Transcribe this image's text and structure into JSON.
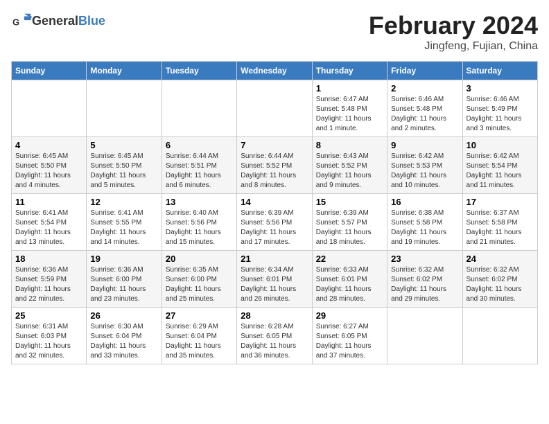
{
  "header": {
    "logo_general": "General",
    "logo_blue": "Blue",
    "month_year": "February 2024",
    "location": "Jingfeng, Fujian, China"
  },
  "weekdays": [
    "Sunday",
    "Monday",
    "Tuesday",
    "Wednesday",
    "Thursday",
    "Friday",
    "Saturday"
  ],
  "weeks": [
    [
      {
        "day": "",
        "sunrise": "",
        "sunset": "",
        "daylight": ""
      },
      {
        "day": "",
        "sunrise": "",
        "sunset": "",
        "daylight": ""
      },
      {
        "day": "",
        "sunrise": "",
        "sunset": "",
        "daylight": ""
      },
      {
        "day": "",
        "sunrise": "",
        "sunset": "",
        "daylight": ""
      },
      {
        "day": "1",
        "sunrise": "Sunrise: 6:47 AM",
        "sunset": "Sunset: 5:48 PM",
        "daylight": "Daylight: 11 hours and 1 minute."
      },
      {
        "day": "2",
        "sunrise": "Sunrise: 6:46 AM",
        "sunset": "Sunset: 5:48 PM",
        "daylight": "Daylight: 11 hours and 2 minutes."
      },
      {
        "day": "3",
        "sunrise": "Sunrise: 6:46 AM",
        "sunset": "Sunset: 5:49 PM",
        "daylight": "Daylight: 11 hours and 3 minutes."
      }
    ],
    [
      {
        "day": "4",
        "sunrise": "Sunrise: 6:45 AM",
        "sunset": "Sunset: 5:50 PM",
        "daylight": "Daylight: 11 hours and 4 minutes."
      },
      {
        "day": "5",
        "sunrise": "Sunrise: 6:45 AM",
        "sunset": "Sunset: 5:50 PM",
        "daylight": "Daylight: 11 hours and 5 minutes."
      },
      {
        "day": "6",
        "sunrise": "Sunrise: 6:44 AM",
        "sunset": "Sunset: 5:51 PM",
        "daylight": "Daylight: 11 hours and 6 minutes."
      },
      {
        "day": "7",
        "sunrise": "Sunrise: 6:44 AM",
        "sunset": "Sunset: 5:52 PM",
        "daylight": "Daylight: 11 hours and 8 minutes."
      },
      {
        "day": "8",
        "sunrise": "Sunrise: 6:43 AM",
        "sunset": "Sunset: 5:52 PM",
        "daylight": "Daylight: 11 hours and 9 minutes."
      },
      {
        "day": "9",
        "sunrise": "Sunrise: 6:42 AM",
        "sunset": "Sunset: 5:53 PM",
        "daylight": "Daylight: 11 hours and 10 minutes."
      },
      {
        "day": "10",
        "sunrise": "Sunrise: 6:42 AM",
        "sunset": "Sunset: 5:54 PM",
        "daylight": "Daylight: 11 hours and 11 minutes."
      }
    ],
    [
      {
        "day": "11",
        "sunrise": "Sunrise: 6:41 AM",
        "sunset": "Sunset: 5:54 PM",
        "daylight": "Daylight: 11 hours and 13 minutes."
      },
      {
        "day": "12",
        "sunrise": "Sunrise: 6:41 AM",
        "sunset": "Sunset: 5:55 PM",
        "daylight": "Daylight: 11 hours and 14 minutes."
      },
      {
        "day": "13",
        "sunrise": "Sunrise: 6:40 AM",
        "sunset": "Sunset: 5:56 PM",
        "daylight": "Daylight: 11 hours and 15 minutes."
      },
      {
        "day": "14",
        "sunrise": "Sunrise: 6:39 AM",
        "sunset": "Sunset: 5:56 PM",
        "daylight": "Daylight: 11 hours and 17 minutes."
      },
      {
        "day": "15",
        "sunrise": "Sunrise: 6:39 AM",
        "sunset": "Sunset: 5:57 PM",
        "daylight": "Daylight: 11 hours and 18 minutes."
      },
      {
        "day": "16",
        "sunrise": "Sunrise: 6:38 AM",
        "sunset": "Sunset: 5:58 PM",
        "daylight": "Daylight: 11 hours and 19 minutes."
      },
      {
        "day": "17",
        "sunrise": "Sunrise: 6:37 AM",
        "sunset": "Sunset: 5:58 PM",
        "daylight": "Daylight: 11 hours and 21 minutes."
      }
    ],
    [
      {
        "day": "18",
        "sunrise": "Sunrise: 6:36 AM",
        "sunset": "Sunset: 5:59 PM",
        "daylight": "Daylight: 11 hours and 22 minutes."
      },
      {
        "day": "19",
        "sunrise": "Sunrise: 6:36 AM",
        "sunset": "Sunset: 6:00 PM",
        "daylight": "Daylight: 11 hours and 23 minutes."
      },
      {
        "day": "20",
        "sunrise": "Sunrise: 6:35 AM",
        "sunset": "Sunset: 6:00 PM",
        "daylight": "Daylight: 11 hours and 25 minutes."
      },
      {
        "day": "21",
        "sunrise": "Sunrise: 6:34 AM",
        "sunset": "Sunset: 6:01 PM",
        "daylight": "Daylight: 11 hours and 26 minutes."
      },
      {
        "day": "22",
        "sunrise": "Sunrise: 6:33 AM",
        "sunset": "Sunset: 6:01 PM",
        "daylight": "Daylight: 11 hours and 28 minutes."
      },
      {
        "day": "23",
        "sunrise": "Sunrise: 6:32 AM",
        "sunset": "Sunset: 6:02 PM",
        "daylight": "Daylight: 11 hours and 29 minutes."
      },
      {
        "day": "24",
        "sunrise": "Sunrise: 6:32 AM",
        "sunset": "Sunset: 6:02 PM",
        "daylight": "Daylight: 11 hours and 30 minutes."
      }
    ],
    [
      {
        "day": "25",
        "sunrise": "Sunrise: 6:31 AM",
        "sunset": "Sunset: 6:03 PM",
        "daylight": "Daylight: 11 hours and 32 minutes."
      },
      {
        "day": "26",
        "sunrise": "Sunrise: 6:30 AM",
        "sunset": "Sunset: 6:04 PM",
        "daylight": "Daylight: 11 hours and 33 minutes."
      },
      {
        "day": "27",
        "sunrise": "Sunrise: 6:29 AM",
        "sunset": "Sunset: 6:04 PM",
        "daylight": "Daylight: 11 hours and 35 minutes."
      },
      {
        "day": "28",
        "sunrise": "Sunrise: 6:28 AM",
        "sunset": "Sunset: 6:05 PM",
        "daylight": "Daylight: 11 hours and 36 minutes."
      },
      {
        "day": "29",
        "sunrise": "Sunrise: 6:27 AM",
        "sunset": "Sunset: 6:05 PM",
        "daylight": "Daylight: 11 hours and 37 minutes."
      },
      {
        "day": "",
        "sunrise": "",
        "sunset": "",
        "daylight": ""
      },
      {
        "day": "",
        "sunrise": "",
        "sunset": "",
        "daylight": ""
      }
    ]
  ]
}
